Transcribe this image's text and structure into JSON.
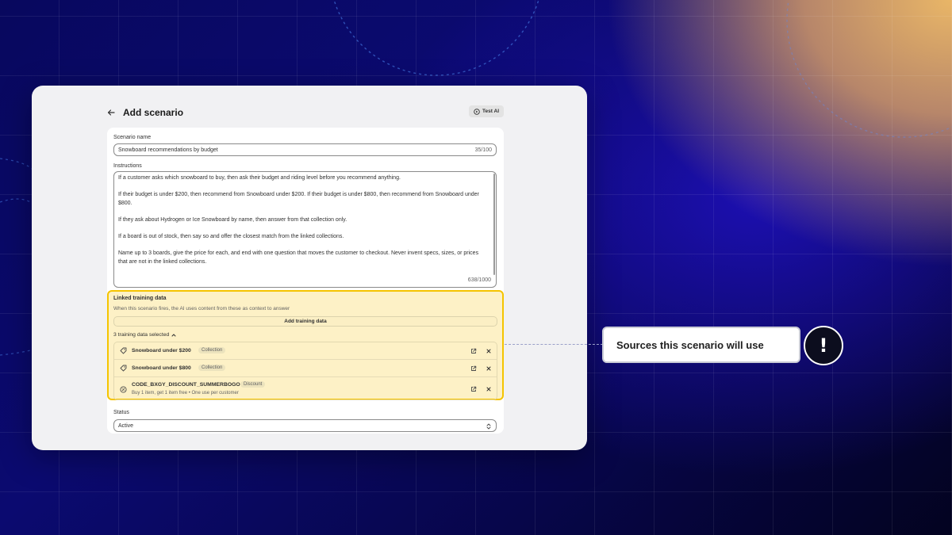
{
  "header": {
    "title": "Add scenario",
    "test_ai_label": "Test AI"
  },
  "scenario_name": {
    "label": "Scenario name",
    "value": "Snowboard recommendations by budget",
    "count": "35/100"
  },
  "instructions": {
    "label": "Instructions",
    "paragraphs": [
      "If a customer asks which snowboard to buy, then ask their budget and riding level before you recommend anything.",
      "If their budget is under $200, then recommend from Snowboard under $200. If their budget is under $800, then recommend from Snowboard under $800.",
      "If they ask about Hydrogen or Ice Snowboard by name, then answer from that collection only.",
      "If a board is out of stock, then say so and offer the closest match from the linked collections.",
      "Name up to 3 boards, give the price for each, and end with one question that moves the customer to checkout. Never invent specs, sizes, or prices that are not in the linked collections."
    ],
    "count": "638/1000"
  },
  "linked_training": {
    "title": "Linked training data",
    "subtitle": "When this scenario fires, the AI uses content from these as context to answer",
    "add_button": "Add training data",
    "selected_label": "3 training data selected",
    "items": [
      {
        "name": "Snowboard under $200",
        "tag": "Collection",
        "icon": "collection-icon"
      },
      {
        "name": "Snowboard under $800",
        "tag": "Collection",
        "icon": "collection-icon"
      },
      {
        "name": "CODE_BXGY_DISCOUNT_SUMMERBOGO",
        "tag": "Discount",
        "description": "Buy 1 item, get 1 item free • One use per customer",
        "icon": "discount-icon"
      }
    ]
  },
  "status": {
    "label": "Status",
    "value": "Active"
  },
  "callout": {
    "text": "Sources this scenario will use",
    "badge": "!"
  },
  "colors": {
    "highlight_border": "#f5c400",
    "highlight_fill": "#fdf1c6",
    "badge_bg": "#0c0d1e"
  }
}
